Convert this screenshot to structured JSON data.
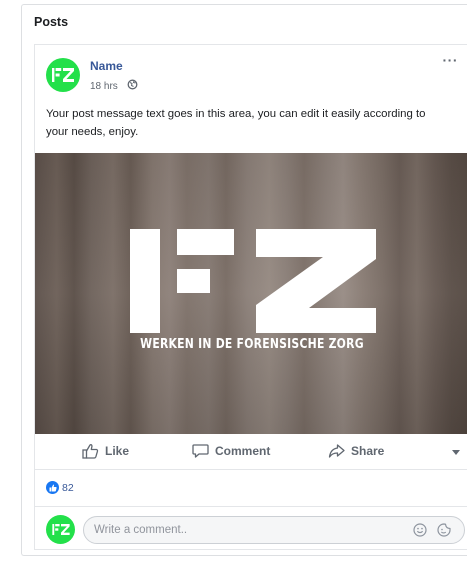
{
  "section": {
    "title": "Posts"
  },
  "post": {
    "author": "Name",
    "time": "18 hrs",
    "more_label": "···",
    "message": "Your post message text goes in this area, you can edit it easily according to your needs, enjoy.",
    "image": {
      "logo_text": "FZ",
      "caption": "WERKEN IN DE FORENSISCHE ZORG"
    },
    "actions": {
      "like": "Like",
      "comment": "Comment",
      "share": "Share"
    },
    "reactions": {
      "count": "82"
    },
    "comment_box": {
      "placeholder": "Write a comment.."
    }
  },
  "colors": {
    "brand_green": "#23e04a",
    "link_blue": "#385898",
    "like_blue": "#1877f2"
  },
  "icons": {
    "globe": "globe-icon",
    "like": "thumbs-up-icon",
    "comment": "speech-bubble-icon",
    "share": "share-arrow-icon",
    "caret": "caret-down-icon",
    "emoji": "smiley-icon",
    "sticker": "sticker-icon"
  }
}
